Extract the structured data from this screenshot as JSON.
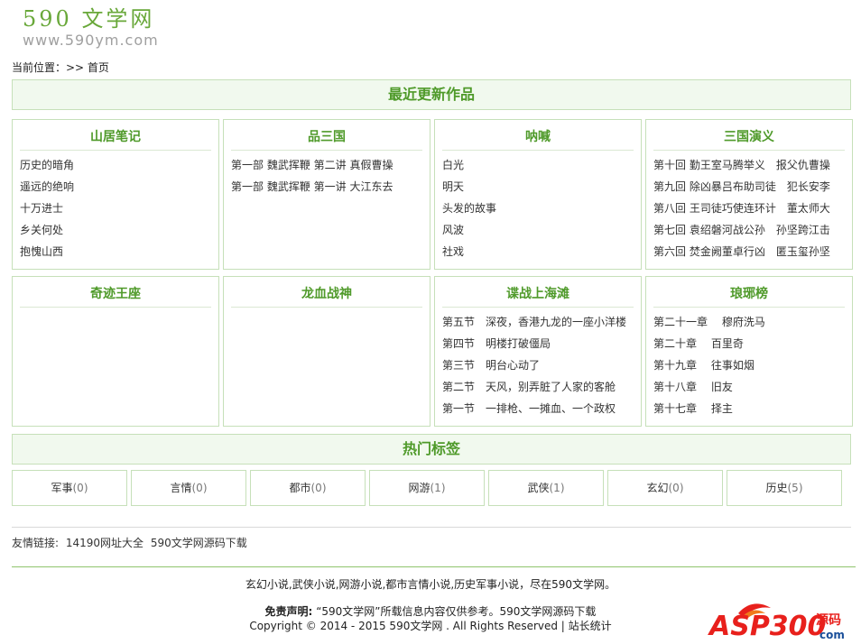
{
  "logo": {
    "title": "590 文学网",
    "url": "www.590ym.com"
  },
  "breadcrumb": {
    "label": "当前位置：>> 首页"
  },
  "recent": {
    "title": "最近更新作品",
    "cards_row1": [
      {
        "title": "山居笔记",
        "items": [
          "历史的暗角",
          "遥远的绝响",
          "十万进士",
          "乡关何处",
          "抱愧山西"
        ]
      },
      {
        "title": "品三国",
        "items": [
          "第一部 魏武挥鞭 第二讲 真假曹操",
          "第一部 魏武挥鞭 第一讲 大江东去"
        ]
      },
      {
        "title": "呐喊",
        "items": [
          "白光",
          "明天",
          "头发的故事",
          "风波",
          "社戏"
        ]
      },
      {
        "title": "三国演义",
        "items": [
          "第十回 勤王室马腾举义　报父仇曹操",
          "第九回 除凶暴吕布助司徒　犯长安李",
          "第八回 王司徒巧使连环计　董太师大",
          "第七回 袁绍磐河战公孙　孙坚跨江击",
          "第六回 焚金阙董卓行凶　匿玉玺孙坚"
        ]
      }
    ],
    "cards_row2": [
      {
        "title": "奇迹王座",
        "items": []
      },
      {
        "title": "龙血战神",
        "items": []
      },
      {
        "title": "谍战上海滩",
        "items": [
          "第五节　深夜，香港九龙的一座小洋楼",
          "第四节　明楼打破僵局",
          "第三节　明台心动了",
          "第二节　天风，别弄脏了人家的客舱",
          "第一节　一排枪、一摊血、一个政权"
        ]
      },
      {
        "title": "琅琊榜",
        "items": [
          "第二十一章　 穆府洗马",
          "第二十章　 百里奇",
          "第十九章　 往事如烟",
          "第十八章　 旧友",
          "第十七章　 择主"
        ]
      }
    ]
  },
  "hot_tags": {
    "title": "热门标签",
    "items": [
      {
        "name": "军事",
        "count": "(0)"
      },
      {
        "name": "言情",
        "count": "(0)"
      },
      {
        "name": "都市",
        "count": "(0)"
      },
      {
        "name": "网游",
        "count": "(1)"
      },
      {
        "name": "武侠",
        "count": "(1)"
      },
      {
        "name": "玄幻",
        "count": "(0)"
      },
      {
        "name": "历史",
        "count": "(5)"
      }
    ]
  },
  "friend_links": {
    "label": "友情链接:",
    "items": [
      "14190网址大全",
      "590文学网源码下载"
    ]
  },
  "footer": {
    "line1": "玄幻小说,武侠小说,网游小说,都市言情小说,历史军事小说，尽在590文学网。",
    "disclaimer_label": "免责声明:",
    "disclaimer_text": "“590文学网”所载信息内容仅供参考。590文学网源码下载",
    "copyright": "Copyright © 2014 - 2015 590文学网 . All Rights Reserved | 站长统计"
  },
  "badge": {
    "text": "ASP300",
    "sub": "源码",
    "domain": "com"
  },
  "colors": {
    "accent": "#4f9a2a",
    "border": "#c6e0b9",
    "banner_bg": "#f1f9ee",
    "logo": "#69a83a",
    "badge_red": "#e8201c"
  }
}
